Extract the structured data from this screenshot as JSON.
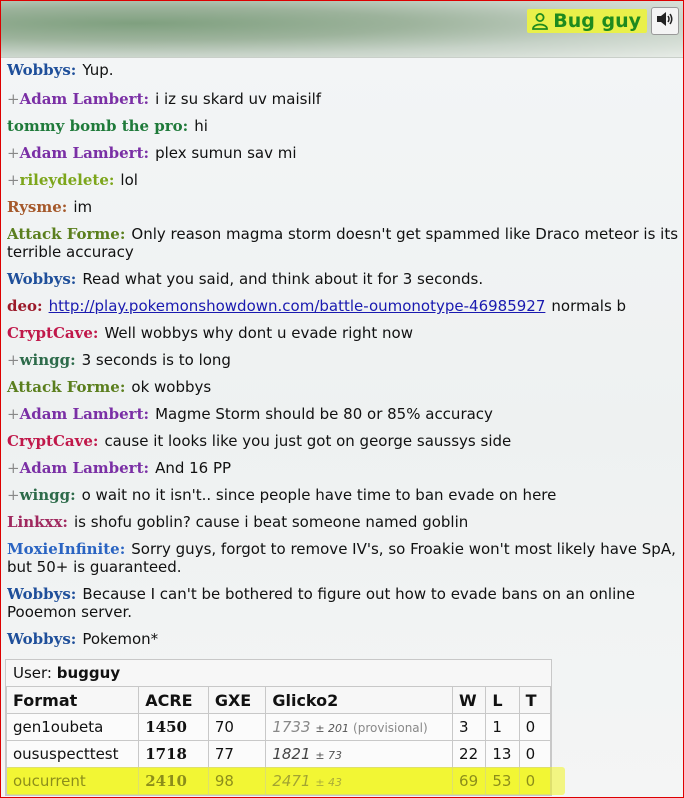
{
  "header": {
    "username": "Bug guy",
    "user_icon": "user-icon",
    "sound_icon": "speaker-icon"
  },
  "messages": [
    {
      "rank": "",
      "name": "Wobbys:",
      "text": "Yup."
    },
    {
      "rank": "+",
      "name": "Adam Lambert:",
      "text": "i iz su skard uv maisilf"
    },
    {
      "rank": "",
      "name": "tommy bomb the pro:",
      "text": "hi"
    },
    {
      "rank": "+",
      "name": "Adam Lambert:",
      "text": "plex sumun sav mi"
    },
    {
      "rank": "+",
      "name": "rileydelete:",
      "text": "lol"
    },
    {
      "rank": "",
      "name": "Rysme:",
      "text": "im"
    },
    {
      "rank": "",
      "name": "Attack Forme:",
      "text": "Only reason magma storm doesn't get spammed like Draco meteor is its terrible accuracy"
    },
    {
      "rank": "",
      "name": "Wobbys:",
      "text": "Read what you said, and think about it for 3 seconds."
    },
    {
      "rank": "",
      "name": "deo:",
      "link": "http://play.pokemonshowdown.com/battle-oumonotype-46985927",
      "text": "normals b"
    },
    {
      "rank": "",
      "name": "CryptCave:",
      "text": "Well wobbys why dont u evade right now"
    },
    {
      "rank": "+",
      "name": "wingg:",
      "text": "3 seconds is to long"
    },
    {
      "rank": "",
      "name": "Attack Forme:",
      "text": "ok wobbys"
    },
    {
      "rank": "+",
      "name": "Adam Lambert:",
      "text": "Magme Storm should be 80 or 85% accuracy"
    },
    {
      "rank": "",
      "name": "CryptCave:",
      "text": "cause it looks like you just got on george saussys side"
    },
    {
      "rank": "+",
      "name": "Adam Lambert:",
      "text": "And 16 PP"
    },
    {
      "rank": "+",
      "name": "wingg:",
      "text": "o wait no it isn't.. since people have time to ban evade on here"
    },
    {
      "rank": "",
      "name": "Linkxx:",
      "text": "is shofu goblin? cause i beat someone named goblin"
    },
    {
      "rank": "",
      "name": "MoxieInfinite:",
      "text": "Sorry guys, forgot to remove IV's, so Froakie won't most likely have SpA, but 50+ is guaranteed."
    },
    {
      "rank": "",
      "name": "Wobbys:",
      "text": "Because I can't be bothered to figure out how to evade bans on an online Pooemon server."
    },
    {
      "rank": "",
      "name": "Wobbys:",
      "text": "Pokemon*"
    }
  ],
  "ladder": {
    "user_label": "User:",
    "user_value": "bugguy",
    "headers": [
      "Format",
      "ACRE",
      "GXE",
      "Glicko2",
      "W",
      "L",
      "T"
    ],
    "rows": [
      {
        "format": "gen1oubeta",
        "acre": "1450",
        "gxe": "70",
        "glicko": "1733",
        "dev": "± 201",
        "note": "(provisional)",
        "w": "3",
        "l": "1",
        "t": "0"
      },
      {
        "format": "oususpecttest",
        "acre": "1718",
        "gxe": "77",
        "glicko": "1821",
        "dev": "± 73",
        "note": "",
        "w": "22",
        "l": "13",
        "t": "0"
      },
      {
        "format": "oucurrent",
        "acre": "2410",
        "gxe": "98",
        "glicko": "2471",
        "dev": "± 43",
        "note": "",
        "w": "69",
        "l": "53",
        "t": "0"
      }
    ]
  },
  "colors": {
    "highlight": "#f0f423",
    "username_text": "#1e8a1e",
    "border_red": "#dd0000"
  }
}
